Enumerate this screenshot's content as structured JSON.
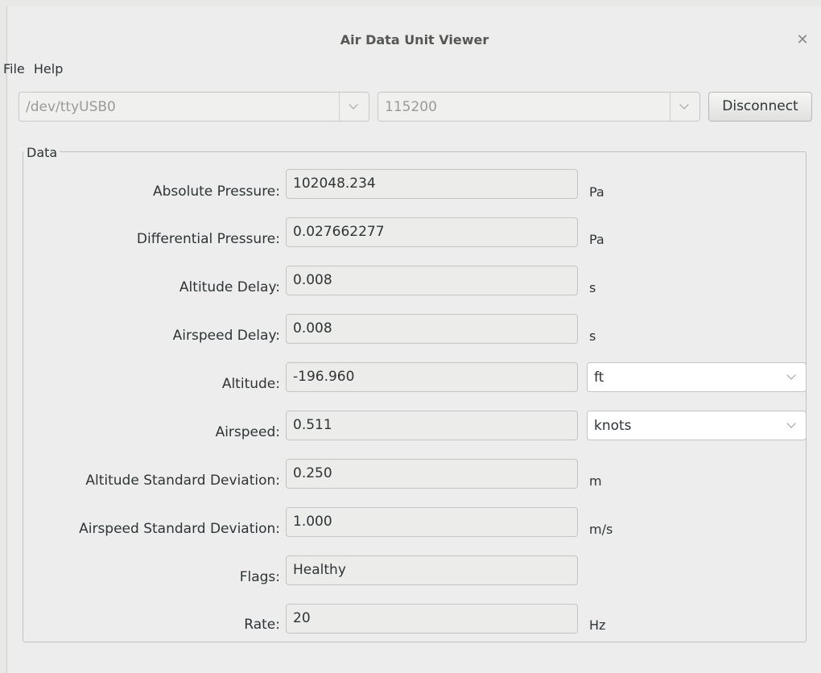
{
  "window": {
    "title": "Air Data Unit Viewer"
  },
  "menu": {
    "file": "File",
    "help": "Help"
  },
  "connection": {
    "port": "/dev/ttyUSB0",
    "baud": "115200",
    "disconnect_label": "Disconnect"
  },
  "data_frame": {
    "label": "Data"
  },
  "fields": {
    "absolute_pressure": {
      "label": "Absolute Pressure:",
      "value": "102048.234",
      "unit": "Pa"
    },
    "differential_pressure": {
      "label": "Differential Pressure:",
      "value": "0.027662277",
      "unit": "Pa"
    },
    "altitude_delay": {
      "label": "Altitude Delay:",
      "value": "0.008",
      "unit": "s"
    },
    "airspeed_delay": {
      "label": "Airspeed Delay:",
      "value": "0.008",
      "unit": "s"
    },
    "altitude": {
      "label": "Altitude:",
      "value": "-196.960",
      "unit": "ft"
    },
    "airspeed": {
      "label": "Airspeed:",
      "value": "0.511",
      "unit": "knots"
    },
    "altitude_std": {
      "label": "Altitude Standard Deviation:",
      "value": "0.250",
      "unit": "m"
    },
    "airspeed_std": {
      "label": "Airspeed Standard Deviation:",
      "value": "1.000",
      "unit": "m/s"
    },
    "flags": {
      "label": "Flags:",
      "value": "Healthy"
    },
    "rate": {
      "label": "Rate:",
      "value": "20",
      "unit": "Hz"
    }
  }
}
